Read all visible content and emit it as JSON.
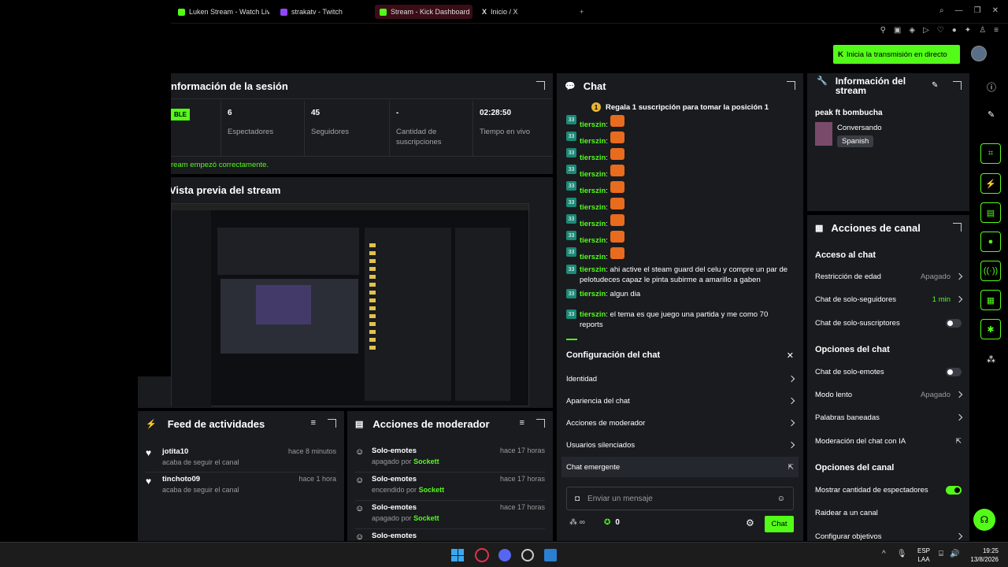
{
  "browser": {
    "tabs": [
      {
        "label": "Luken Stream - Watch Live",
        "color": "#53fc18"
      },
      {
        "label": "strakatv - Twitch",
        "color": "#9146ff"
      },
      {
        "label": "Stream - Kick Dashboard",
        "color": "#53fc18",
        "active": true
      },
      {
        "label": "Inicio / X",
        "color": "#ffffff"
      }
    ],
    "new_tab": "+"
  },
  "header": {
    "go_live_label": "Inicia la transmisión en directo"
  },
  "session": {
    "title": "nformación de la sesión",
    "status_badge": "BLE",
    "stats": [
      {
        "value": "6",
        "label": "Espectadores"
      },
      {
        "value": "45",
        "label": "Seguidores"
      },
      {
        "value": "-",
        "label": "Cantidad de suscripciones"
      },
      {
        "value": "02:28:50",
        "label": "Tiempo en vivo"
      }
    ],
    "status_message": "ream empezó correctamente."
  },
  "preview": {
    "title": "Vista previa del stream"
  },
  "chat": {
    "title": "Chat",
    "pinned": "Regala 1 suscripción para tomar la posición 1",
    "pinned_rank": "1",
    "badge_text": "33",
    "messages": [
      {
        "user": "tierszin",
        "text": ""
      },
      {
        "user": "tierszin",
        "text": ""
      },
      {
        "user": "tierszin",
        "text": ""
      },
      {
        "user": "tierszin",
        "text": ""
      },
      {
        "user": "tierszin",
        "text": ""
      },
      {
        "user": "tierszin",
        "text": ""
      },
      {
        "user": "tierszin",
        "text": ""
      },
      {
        "user": "tierszin",
        "text": ""
      },
      {
        "user": "tierszin",
        "text": ""
      },
      {
        "user": "tierszin",
        "text": "ahi active el steam guard del celu y compre un par de pelotudeces capaz le pinta subirme a amarillo a gaben"
      },
      {
        "user": "tierszin",
        "text": "algun dia"
      },
      {
        "user": "tierszin",
        "text": "el tema es que juego una partida y me como 70 reports"
      }
    ],
    "config": {
      "title": "Configuración del chat",
      "items": [
        "Identidad",
        "Apariencia del chat",
        "Acciones de moderador",
        "Usuarios silenciados"
      ],
      "popout": "Chat emergente"
    },
    "input_placeholder": "Enviar un mensaje",
    "points": "0",
    "send_label": "Chat"
  },
  "stream_info": {
    "title": "Información del stream",
    "stream_title": "peak ft bombucha",
    "category": "Conversando",
    "language": "Spanish"
  },
  "channel_actions": {
    "title": "Acciones de canal",
    "sections": [
      {
        "title": "Acceso al chat",
        "items": [
          {
            "label": "Restricción de edad",
            "value": "Apagado",
            "kind": "chevron"
          },
          {
            "label": "Chat de solo-seguidores",
            "value": "1 min",
            "kind": "chevron",
            "green": true
          },
          {
            "label": "Chat de solo-suscriptores",
            "value": "",
            "kind": "toggle",
            "on": false
          }
        ]
      },
      {
        "title": "Opciones del chat",
        "items": [
          {
            "label": "Chat de solo-emotes",
            "value": "",
            "kind": "toggle",
            "on": false
          },
          {
            "label": "Modo lento",
            "value": "Apagado",
            "kind": "chevron"
          },
          {
            "label": "Palabras baneadas",
            "value": "",
            "kind": "chevron"
          },
          {
            "label": "Moderación del chat con IA",
            "value": "",
            "kind": "external"
          }
        ]
      },
      {
        "title": "Opciones del canal",
        "items": [
          {
            "label": "Mostrar cantidad de espectadores",
            "value": "",
            "kind": "toggle",
            "on": true
          },
          {
            "label": "Raidear a un canal",
            "value": "",
            "kind": "none"
          },
          {
            "label": "Configurar objetivos",
            "value": "",
            "kind": "chevron"
          }
        ]
      }
    ]
  },
  "feed": {
    "title": "Feed de actividades",
    "items": [
      {
        "user": "jotita10",
        "action": "acaba de seguir el canal",
        "time": "hace 8 minutos"
      },
      {
        "user": "tinchoto09",
        "action": "acaba de seguir el canal",
        "time": "hace 1 hora"
      }
    ]
  },
  "mod_actions": {
    "title": "Acciones de moderador",
    "items": [
      {
        "title": "Solo-emotes",
        "prefix": "apagado por",
        "by": "Sockett",
        "time": "hace 17 horas"
      },
      {
        "title": "Solo-emotes",
        "prefix": "encendido por",
        "by": "Sockett",
        "time": "hace 17 horas"
      },
      {
        "title": "Solo-emotes",
        "prefix": "apagado por",
        "by": "Sockett",
        "time": "hace 17 horas"
      },
      {
        "title": "Solo-emotes",
        "prefix": "",
        "by": "",
        "time": ""
      }
    ]
  },
  "taskbar": {
    "lang_top": "ESP",
    "lang_bottom": "LAA",
    "time": "19:25",
    "date": "13/8/2026"
  }
}
